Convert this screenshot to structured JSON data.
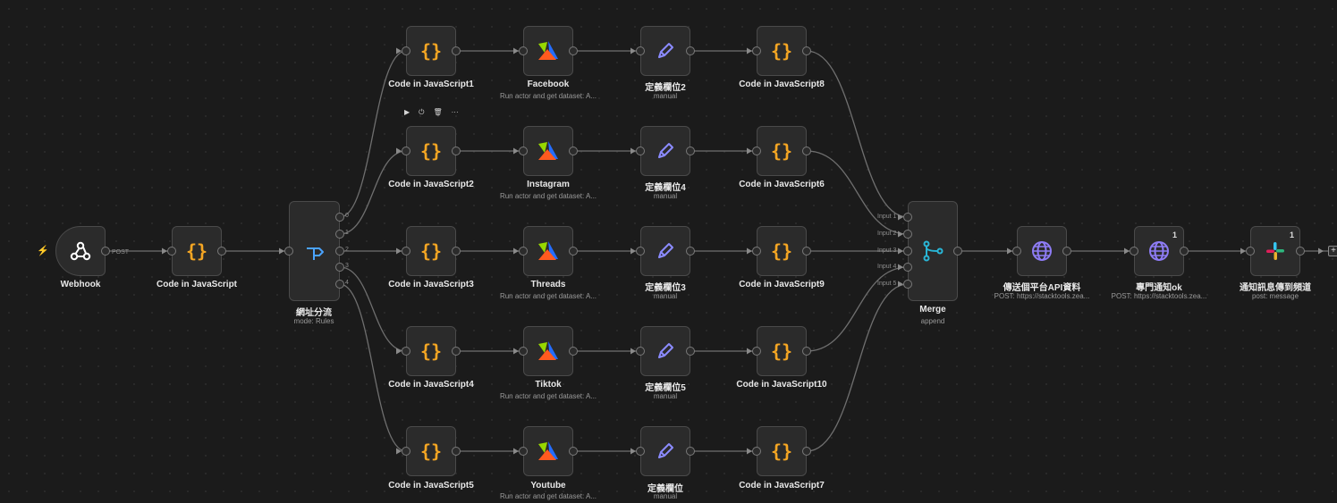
{
  "app": {
    "connection_label": "POST"
  },
  "nodes": {
    "webhook": {
      "label": "Webhook",
      "icon": "webhook-icon"
    },
    "code_main": {
      "label": "Code in JavaScript",
      "icon": "code-braces-icon"
    },
    "switch": {
      "label": "網址分流",
      "sub": "mode: Rules",
      "icon": "switch-route-icon",
      "outputs": [
        "0",
        "1",
        "2",
        "3",
        "4"
      ]
    },
    "code1": {
      "label": "Code in JavaScript1"
    },
    "code2": {
      "label": "Code in JavaScript2"
    },
    "code3": {
      "label": "Code in JavaScript3"
    },
    "code4": {
      "label": "Code in JavaScript4"
    },
    "code5": {
      "label": "Code in JavaScript5"
    },
    "facebook": {
      "label": "Facebook",
      "sub": "Run actor and get dataset: A..."
    },
    "instagram": {
      "label": "Instagram",
      "sub": "Run actor and get dataset: A..."
    },
    "threads": {
      "label": "Threads",
      "sub": "Run actor and get dataset: A..."
    },
    "tiktok": {
      "label": "Tiktok",
      "sub": "Run actor and get dataset: A..."
    },
    "youtube": {
      "label": "Youtube",
      "sub": "Run actor and get dataset: A..."
    },
    "set2": {
      "label": "定義欄位2",
      "sub": "manual"
    },
    "set4": {
      "label": "定義欄位4",
      "sub": "manual"
    },
    "set3": {
      "label": "定義欄位3",
      "sub": "manual"
    },
    "set5": {
      "label": "定義欄位5",
      "sub": "manual"
    },
    "set": {
      "label": "定義欄位",
      "sub": "manual"
    },
    "code8": {
      "label": "Code in JavaScript8"
    },
    "code6": {
      "label": "Code in JavaScript6"
    },
    "code9": {
      "label": "Code in JavaScript9"
    },
    "code10": {
      "label": "Code in JavaScript10"
    },
    "code7": {
      "label": "Code in JavaScript7"
    },
    "merge": {
      "label": "Merge",
      "sub": "append",
      "icon": "merge-icon",
      "inputs": [
        "Input 1",
        "Input 2",
        "Input 3",
        "Input 4",
        "Input 5"
      ]
    },
    "http1": {
      "label": "傳送個平台API資料",
      "sub": "POST: https://stacktools.zea...",
      "icon": "globe-icon"
    },
    "http2": {
      "label": "專門通知ok",
      "sub": "POST: https://stacktools.zea...",
      "icon": "globe-icon",
      "badge": "1"
    },
    "slack": {
      "label": "通知訊息傳到頻道",
      "sub": "post: message",
      "icon": "slack-icon",
      "badge": "1"
    }
  },
  "toolbar": {
    "items": [
      "▶",
      "⏻",
      "🗑",
      "···"
    ]
  },
  "colors": {
    "code": "#f5a623",
    "pen": "#8b8bff",
    "globe": "#8e7cf5",
    "merge": "#29b6d6",
    "switch": "#4aa3ff",
    "trigger_bolt": "#ff5a5a"
  }
}
